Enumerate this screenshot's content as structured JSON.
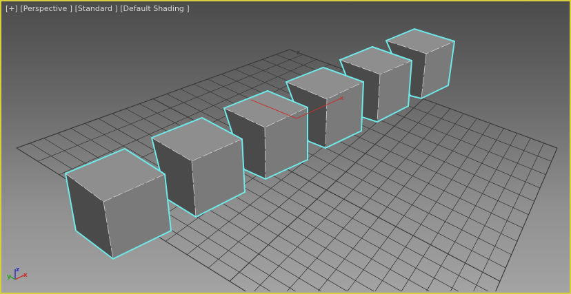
{
  "viewport": {
    "menu_plus": "[+]",
    "view_label": "[Perspective ]",
    "style_label": "[Standard ]",
    "shading_label": "[Default Shading ]"
  },
  "gizmo": {
    "x": "x",
    "y": "y",
    "z": "z"
  },
  "grid_axis_label": "z",
  "colors": {
    "selection": "#6fe8e8",
    "border": "#d8cf3c",
    "x_axis": "#c83030",
    "y_axis": "#30a030",
    "z_axis": "#3030c0"
  }
}
